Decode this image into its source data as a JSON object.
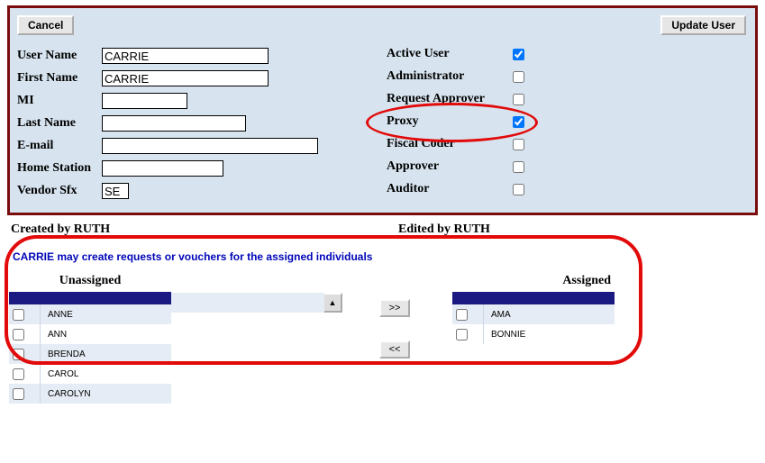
{
  "buttons": {
    "cancel": "Cancel",
    "update": "Update User",
    "move_right": ">>",
    "move_left": "<<"
  },
  "form": {
    "labels": {
      "user_name": "User Name",
      "first_name": "First Name",
      "mi": "MI",
      "last_name": "Last Name",
      "email": "E-mail",
      "home_station": "Home Station",
      "vendor_sfx": "Vendor Sfx"
    },
    "values": {
      "user_name": "CARRIE",
      "first_name": "CARRIE",
      "mi": "",
      "last_name": "",
      "email": "",
      "home_station": "",
      "vendor_sfx": "SE"
    }
  },
  "roles": {
    "labels": {
      "active_user": "Active User",
      "administrator": "Administrator",
      "request_approver": "Request Approver",
      "proxy": "Proxy",
      "fiscal_coder": "Fiscal Coder",
      "approver": "Approver",
      "auditor": "Auditor"
    },
    "checked": {
      "active_user": true,
      "administrator": false,
      "request_approver": false,
      "proxy": true,
      "fiscal_coder": false,
      "approver": false,
      "auditor": false
    }
  },
  "meta": {
    "created_label": "Created by ",
    "created_value": "RUTH",
    "edited_label": "Edited by ",
    "edited_value": "RUTH"
  },
  "assignment": {
    "heading": "CARRIE may create requests or vouchers for the assigned individuals",
    "unassigned_label": "Unassigned",
    "assigned_label": "Assigned",
    "unassigned": [
      "ANNE",
      "ANN",
      "BRENDA",
      "CAROL",
      "CAROLYN"
    ],
    "assigned": [
      "AMA",
      "BONNIE"
    ]
  },
  "icons": {
    "scroll_up": "▲"
  }
}
